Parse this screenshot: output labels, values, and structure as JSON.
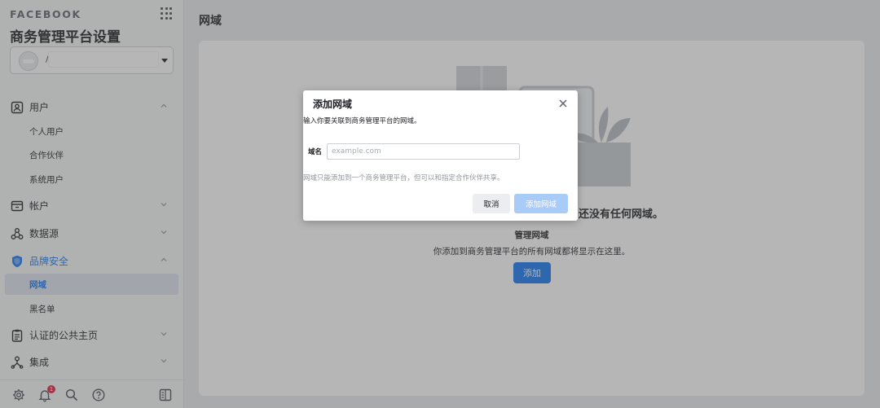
{
  "sidebar": {
    "brand": "FACEBOOK",
    "settings_title": "商务管理平台设置",
    "account": {
      "name_prefix": "/"
    },
    "nav": {
      "users": "用户",
      "users_sub": [
        "个人用户",
        "合作伙伴",
        "系统用户"
      ],
      "accounts": "帐户",
      "data_sources": "数据源",
      "brand_safety": "品牌安全",
      "brand_sub": [
        "网域",
        "黑名单"
      ],
      "verified_pages": "认证的公共主页",
      "integrations": "集成"
    },
    "notification_count": "1",
    "accent": "#1877f2"
  },
  "main": {
    "title": "网域",
    "empty_title": "还没有任何网域。",
    "empty_sub": "管理网域",
    "empty_desc": "你添加到商务管理平台的所有网域都将显示在这里。",
    "add_button": "添加"
  },
  "dialog": {
    "title": "添加网域",
    "description": "输入你要关联到商务管理平台的网域。",
    "field_label": "域名",
    "field_placeholder": "example.com",
    "field_value": "",
    "note": "网域只能添加到一个商务管理平台，但可以和指定合作伙伴共享。",
    "cancel": "取消",
    "confirm": "添加网域"
  }
}
